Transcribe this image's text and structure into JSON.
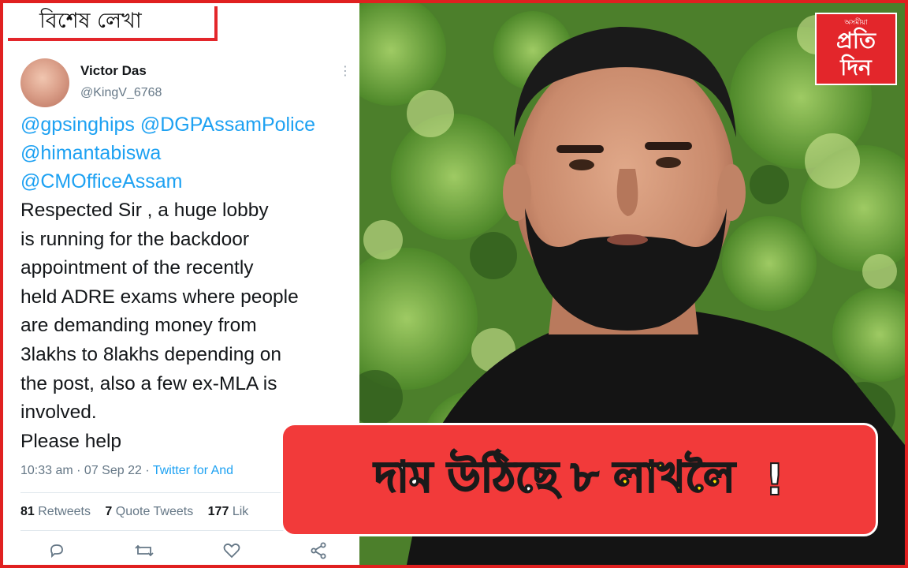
{
  "section_tag": "বিশেষ লেখা",
  "tweet": {
    "name": "Victor Das",
    "handle": "@KingV_6768",
    "more_icon": "ellipsis-vertical",
    "mentions": [
      "@gpsinghips @DGPAssamPolice",
      "@himantabiswa",
      "@CMOfficeAssam"
    ],
    "lines": [
      "Respected Sir , a huge lobby",
      "is running for the backdoor",
      "appointment of the recently",
      "held ADRE exams where people",
      "are demanding money from",
      "3lakhs to 8lakhs depending on",
      "the post, also a few ex-MLA is",
      "involved.",
      "Please help"
    ],
    "time": "10:33 am · 07 Sep 22 ·",
    "source": "Twitter for And",
    "retweets_count": "81",
    "retweets_label": "Retweets",
    "quotes_count": "7",
    "quotes_label": "Quote Tweets",
    "likes_count": "177",
    "likes_label": "Lik",
    "actions": [
      "reply-icon",
      "retweet-icon",
      "like-icon",
      "share-icon"
    ]
  },
  "logo": {
    "small": "অসমীয়া",
    "line1": "প্রতি",
    "line2": "দিন"
  },
  "headline": {
    "part1": "দাম উঠিছে",
    "part2": "৮ লাখলৈ",
    "part3": "!"
  },
  "colors": {
    "brand_red": "#e3262b",
    "twitter_blue": "#1da1f2",
    "headline_yellow": "#ffe100"
  }
}
